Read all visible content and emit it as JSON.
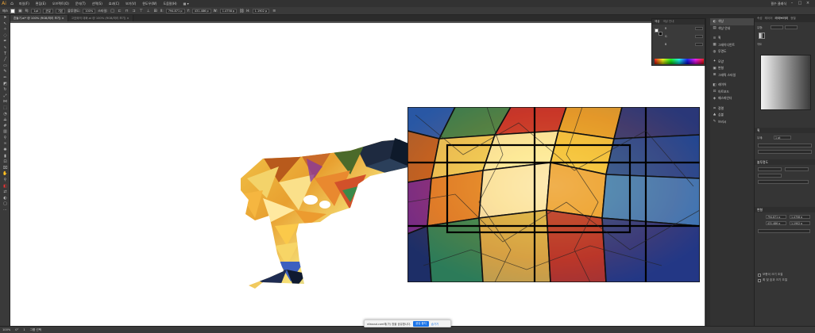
{
  "menubar": {
    "logo": "Ai",
    "items": [
      "파일(F)",
      "편집(E)",
      "오브젝트(O)",
      "문자(T)",
      "선택(S)",
      "효과(C)",
      "보기(V)",
      "윈도우(W)",
      "도움말(H)"
    ],
    "workspace": "필수 클래식"
  },
  "controlbar": {
    "selection_label": "패스",
    "stroke_label": "획:",
    "stroke_value": "1pt",
    "brush_label": "균일",
    "basic_label": "기본",
    "opacity_label": "불투명도:",
    "opacity_value": "100%",
    "style_label": "스타일:",
    "x_label": "X:",
    "x_value": "794.871 p",
    "y_label": "Y:",
    "y_value": "431.486 p",
    "w_label": "W:",
    "w_value": "1.4758 p",
    "h_label": "H:",
    "h_value": "1.1902 p"
  },
  "tabs": {
    "active": "흔들기.ai* @ 100% (RGB/미리 보기) ×",
    "inactive": "고흐와의 대화.ai @ 100% (RGB/미리 보기) ×"
  },
  "color_panel": {
    "tab1": "색상",
    "tab2": "색상 안내",
    "value_r": "R",
    "value_g": "G",
    "value_b": "B"
  },
  "panel_list": {
    "items": [
      {
        "icon": "◐",
        "label": "색상",
        "selected": true
      },
      {
        "icon": "▤",
        "label": "색상 안내",
        "selected": false
      },
      {
        "icon": "≡",
        "label": "획",
        "selected": false
      },
      {
        "icon": "▦",
        "label": "그레이디언트",
        "selected": false
      },
      {
        "icon": "◍",
        "label": "투명도",
        "selected": false
      },
      {
        "icon": "✦",
        "label": "모양",
        "selected": false
      },
      {
        "icon": "▣",
        "label": "변형",
        "selected": false
      },
      {
        "icon": "⊞",
        "label": "그래픽 스타일",
        "selected": false
      },
      {
        "icon": "◧",
        "label": "레이어",
        "selected": false
      },
      {
        "icon": "⊡",
        "label": "아트보드",
        "selected": false
      },
      {
        "icon": "◈",
        "label": "패스파인더",
        "selected": false
      },
      {
        "icon": "⌗",
        "label": "정렬",
        "selected": false
      },
      {
        "icon": "♣",
        "label": "심볼",
        "selected": false
      },
      {
        "icon": "✎",
        "label": "브러시",
        "selected": false
      }
    ]
  },
  "right_panel": {
    "tabs": [
      "속성",
      "레이어",
      "라이브러리",
      "정렬"
    ],
    "tab_on": "라이브러리",
    "type_label": "유형:",
    "angle_label": "각도",
    "stroke_section": "획",
    "weight_label": "두께:",
    "weight_value": "1 pt",
    "opacity_section": "불투명도",
    "transform_section": "변형",
    "tx_value": "794.871 p",
    "ty_value": "431.486 p",
    "tw_value": "1.4758 p",
    "th_value": "1.1902 p",
    "checkbox1": "모퉁이 크기 조절",
    "checkbox2": "획 및 효과 크기 조절"
  },
  "status": {
    "zoom": "100%",
    "angle": "0°",
    "artboard": "1",
    "tool": "그룹 선택"
  },
  "notify": {
    "text": "nfasssd.com에(가) 창을 공유합니다.",
    "stop_button": "공유 중지",
    "hide_link": "숨기기"
  },
  "colors": {
    "accent": "#1a73e8",
    "panel_bg": "#323232",
    "canvas_bg": "#ffffff"
  }
}
